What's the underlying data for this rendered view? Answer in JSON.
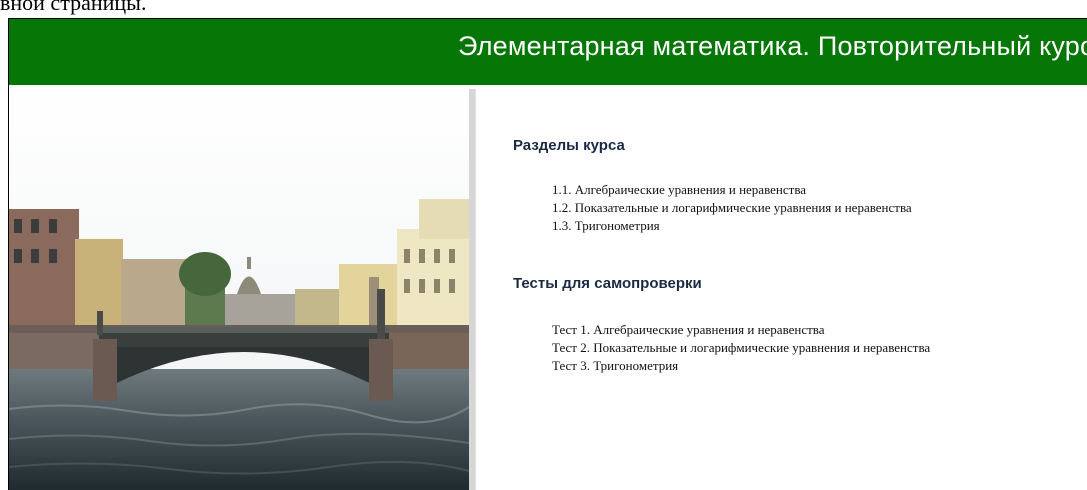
{
  "top_caption": "вной страницы.",
  "header": {
    "title": "Элементарная математика. Повторительный курс"
  },
  "colors": {
    "header_bg": "#067606",
    "header_text": "#ffffff",
    "heading_text": "#1b2a44",
    "divider": "#d6d6d6"
  },
  "photo": {
    "icon": "river-bridge-photo"
  },
  "sections": [
    {
      "heading": "Разделы курса",
      "items": [
        {
          "label": "1.1. Алгебраические уравнения и неравенства"
        },
        {
          "label": "1.2. Показательные и логарифмические уравнения и неравенства"
        },
        {
          "label": "1.3. Тригонометрия"
        }
      ]
    },
    {
      "heading": "Тесты для самопроверки",
      "items": [
        {
          "label": "Тест 1. Алгебраические уравнения и неравенства"
        },
        {
          "label": "Тест 2. Показательные и логарифмические уравнения и неравенства"
        },
        {
          "label": "Тест 3. Тригонометрия"
        }
      ]
    }
  ]
}
